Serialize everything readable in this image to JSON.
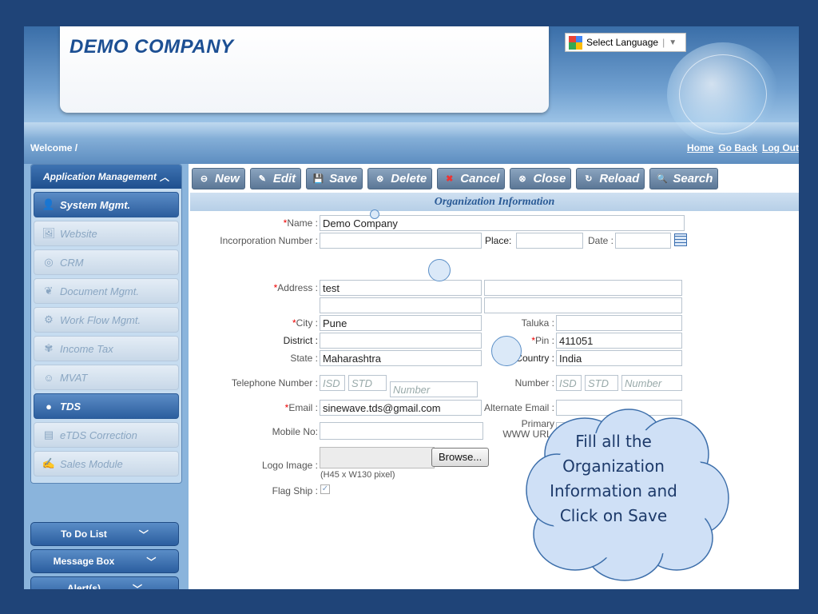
{
  "header": {
    "company": "DEMO COMPANY",
    "language_label": "Select Language",
    "welcome": "Welcome /",
    "links": [
      "Home",
      "Go Back",
      "Log Out"
    ]
  },
  "sidebar": {
    "title": "Application Management",
    "items": [
      {
        "label": "System Mgmt.",
        "icon": "user-icon",
        "active": true
      },
      {
        "label": "Website",
        "icon": "website-icon",
        "active": false
      },
      {
        "label": "CRM",
        "icon": "crm-icon",
        "active": false
      },
      {
        "label": "Document Mgmt.",
        "icon": "document-icon",
        "active": false
      },
      {
        "label": "Work Flow Mgmt.",
        "icon": "workflow-icon",
        "active": false
      },
      {
        "label": "Income Tax",
        "icon": "income-tax-icon",
        "active": false
      },
      {
        "label": "MVAT",
        "icon": "mvat-icon",
        "active": false
      },
      {
        "label": "TDS",
        "icon": "tds-icon",
        "active": true
      },
      {
        "label": "eTDS Correction",
        "icon": "etds-icon",
        "active": false
      },
      {
        "label": "Sales Module",
        "icon": "sales-icon",
        "active": false
      }
    ],
    "panels": [
      "To Do List",
      "Message Box",
      "Alert(s)"
    ]
  },
  "toolbar": {
    "new": "New",
    "edit": "Edit",
    "save": "Save",
    "delete": "Delete",
    "cancel": "Cancel",
    "close": "Close",
    "reload": "Reload",
    "search": "Search"
  },
  "form": {
    "title": "Organization Information",
    "name_label": "Name :",
    "name_value": "Demo Company",
    "incorporation_label": "Incorporation Number :",
    "place_label": "Place:",
    "date_label": "Date :",
    "address_label": "Address :",
    "address_value": "test",
    "city_label": "City :",
    "city_value": "Pune",
    "taluka_label": "Taluka :",
    "district_label": "District :",
    "pin_label": "Pin :",
    "pin_value": "411051",
    "state_label": "State :",
    "state_value": "Maharashtra",
    "country_label": "Country :",
    "country_value": "India",
    "telephone_label": "Telephone Number :",
    "fax_label": "Number :",
    "isd": "ISD",
    "std": "STD",
    "number": "Number",
    "email_label": "Email :",
    "email_value": "sinewave.tds@gmail.com",
    "alt_email_label": "Alternate Email :",
    "mobile_label": "Mobile No:",
    "www_label": "Primary WWW URL:",
    "logo_label": "Logo Image :",
    "browse": "Browse...",
    "logo_hint": "(H45 x W130 pixel)",
    "flagship_label": "Flag Ship :",
    "required_mark": "*"
  },
  "callout": {
    "text": "Fill all the Organization Information and Click on Save"
  },
  "colors": {
    "background": "#1f4478",
    "accent": "#2a5a96"
  }
}
